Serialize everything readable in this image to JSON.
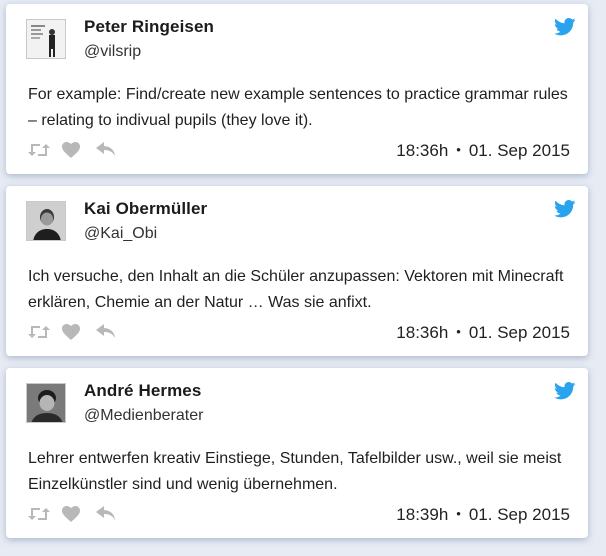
{
  "colors": {
    "twitter_blue": "#2aa3ef",
    "action_gray": "#b8b8b8"
  },
  "tweets": [
    {
      "name": "Peter Ringeisen",
      "handle": "@vilsrip",
      "text": "For example: Find/create new example sentences to practice grammar rules – relating to indivual pupils (they love it).",
      "time": "18:36h",
      "date": "01. Sep 2015",
      "separator": "•"
    },
    {
      "name": "Kai Obermüller",
      "handle": "@Kai_Obi",
      "text": "Ich versuche, den Inhalt an die Schüler anzupassen: Vektoren mit Minecraft erklären, Chemie an der Natur … Was sie anfixt.",
      "time": "18:36h",
      "date": "01. Sep 2015",
      "separator": "•"
    },
    {
      "name": "André Hermes",
      "handle": "@Medienberater",
      "text": "Lehrer entwerfen kreativ Einstiege, Stunden, Tafelbilder usw., weil sie meist Einzelkünstler sind und wenig übernehmen.",
      "time": "18:39h",
      "date": "01. Sep 2015",
      "separator": "•"
    }
  ]
}
